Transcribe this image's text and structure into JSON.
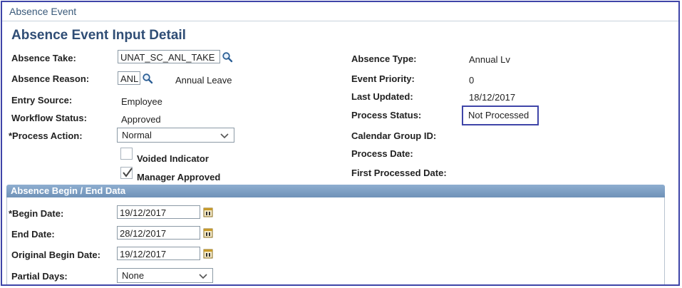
{
  "tab": {
    "title": "Absence Event"
  },
  "page_title": "Absence Event Input Detail",
  "left": {
    "absence_take": {
      "label": "Absence Take:",
      "value": "UNAT_SC_ANL_TAKE"
    },
    "absence_reason": {
      "label": "Absence Reason:",
      "value": "ANL",
      "description": "Annual Leave"
    },
    "entry_source": {
      "label": "Entry Source:",
      "value": "Employee"
    },
    "workflow_status": {
      "label": "Workflow Status:",
      "value": "Approved"
    },
    "process_action": {
      "label": "*Process Action:",
      "value": "Normal"
    },
    "voided_indicator": {
      "label": "Voided Indicator",
      "checked": false
    },
    "manager_approved": {
      "label": "Manager Approved",
      "checked": true
    }
  },
  "right": {
    "absence_type": {
      "label": "Absence Type:",
      "value": "Annual Lv"
    },
    "event_priority": {
      "label": "Event Priority:",
      "value": "0"
    },
    "last_updated": {
      "label": "Last Updated:",
      "value": "18/12/2017"
    },
    "process_status": {
      "label": "Process Status:",
      "value": "Not Processed"
    },
    "calendar_group_id": {
      "label": "Calendar Group ID:",
      "value": ""
    },
    "process_date": {
      "label": "Process Date:",
      "value": ""
    },
    "first_processed_date": {
      "label": "First Processed Date:",
      "value": ""
    }
  },
  "section": {
    "title": "Absence Begin / End Data",
    "begin_date": {
      "label": "*Begin Date:",
      "value": "19/12/2017"
    },
    "end_date": {
      "label": "End Date:",
      "value": "28/12/2017"
    },
    "original_begin_date": {
      "label": "Original Begin Date:",
      "value": "19/12/2017"
    },
    "partial_days": {
      "label": "Partial Days:",
      "value": "None"
    }
  },
  "colors": {
    "highlight_border": "#3f45a8",
    "title": "#2f4d75",
    "section_bar": "#7b9cc2"
  },
  "icons": [
    "magnifier-icon",
    "calendar-icon",
    "chevron-down-icon",
    "checkmark-icon"
  ]
}
